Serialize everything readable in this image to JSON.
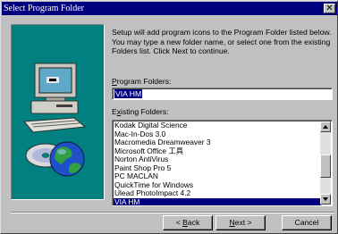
{
  "window": {
    "title": "Select Program Folder",
    "close_glyph": "✕"
  },
  "instructions": "Setup will add program icons to the Program Folder listed below. You may type a new folder name, or select one from the existing Folders list.  Click Next to continue.",
  "program_folders": {
    "label_accel": "P",
    "label_rest": "rogram Folders:",
    "value": "VIA HM"
  },
  "existing_folders": {
    "label_first": "E",
    "label_accel": "x",
    "label_rest": "isting Folders:",
    "items": [
      "Kodak Digital Science",
      "Mac-In-Dos 3.0",
      "Macromedia Dreamweaver 3",
      "Microsoft Office 工具",
      "Norton AntiVirus",
      "Paint Shop Pro 5",
      "PC MACLAN",
      "QuickTime for Windows",
      "Ulead PhotoImpact 4.2",
      "VIA HM"
    ],
    "selected_item": "VIA HM"
  },
  "buttons": {
    "back_prefix": "< ",
    "back_accel": "B",
    "back_rest": "ack",
    "next_accel": "N",
    "next_rest": "ext >",
    "cancel": "Cancel"
  },
  "colors": {
    "titlebar": "#00007f",
    "panel_teal": "#008080",
    "face": "#c0c0c0",
    "selection": "#00007f"
  },
  "icons": [
    "computer-icon",
    "disc-icon",
    "globe-icon",
    "close-icon",
    "scroll-up-icon",
    "scroll-down-icon"
  ]
}
